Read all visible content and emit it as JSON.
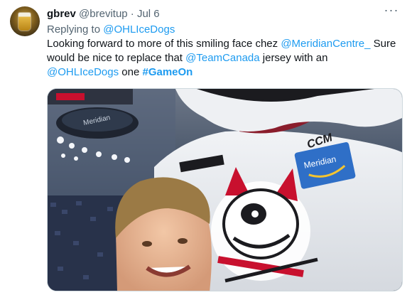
{
  "tweet": {
    "display_name": "gbrev",
    "handle": "@brevitup",
    "separator": "·",
    "date": "Jul 6",
    "more_glyph": "···",
    "replying_prefix": "Replying to",
    "replying_to": "@OHLIceDogs",
    "text": {
      "p1": "Looking forward to more of this smiling face chez",
      "m1": "@MeridianCentre_",
      "p2": "Sure would be nice to replace that",
      "m2": "@TeamCanada",
      "p3": "jersey with an",
      "m3": "@OHLIceDogs",
      "p4": "one",
      "hashtag": "#GameOn"
    }
  },
  "media": {
    "jersey_logo_text": "Meridian",
    "jersey_brand_text": "CCM",
    "scoreboard_text": "Meridian"
  },
  "colors": {
    "link": "#1d9bf0",
    "muted": "#536471",
    "text": "#0f1419"
  }
}
